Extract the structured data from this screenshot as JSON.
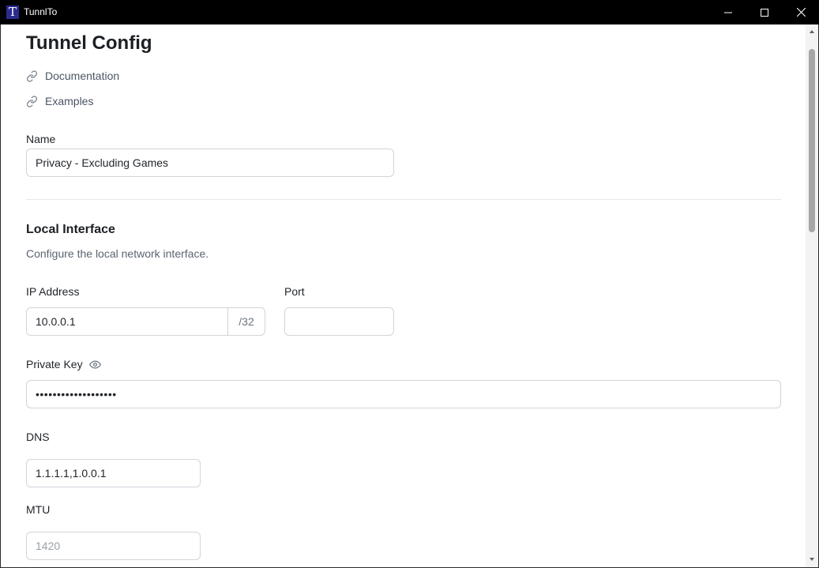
{
  "window": {
    "app_icon_letter": "T",
    "title": "TunnlTo"
  },
  "page": {
    "title": "Tunnel Config",
    "links": [
      {
        "label": "Documentation",
        "icon": "link-icon"
      },
      {
        "label": "Examples",
        "icon": "link-icon"
      }
    ]
  },
  "name_field": {
    "label": "Name",
    "value": "Privacy - Excluding Games"
  },
  "local_interface": {
    "title": "Local Interface",
    "description": "Configure the local network interface.",
    "ip_address": {
      "label": "IP Address",
      "value": "10.0.0.1",
      "suffix": "/32"
    },
    "port": {
      "label": "Port",
      "value": ""
    },
    "private_key": {
      "label": "Private Key",
      "value": "•••••••••••••••••••",
      "toggle_icon": "eye-icon"
    },
    "dns": {
      "label": "DNS",
      "value": "1.1.1.1,1.0.0.1"
    },
    "mtu": {
      "label": "MTU",
      "placeholder": "1420"
    }
  },
  "colors": {
    "titlebar_bg": "#000000",
    "app_icon_bg": "#2b2b8f",
    "input_border": "#d0d4da",
    "divider": "#e5e7eb"
  }
}
